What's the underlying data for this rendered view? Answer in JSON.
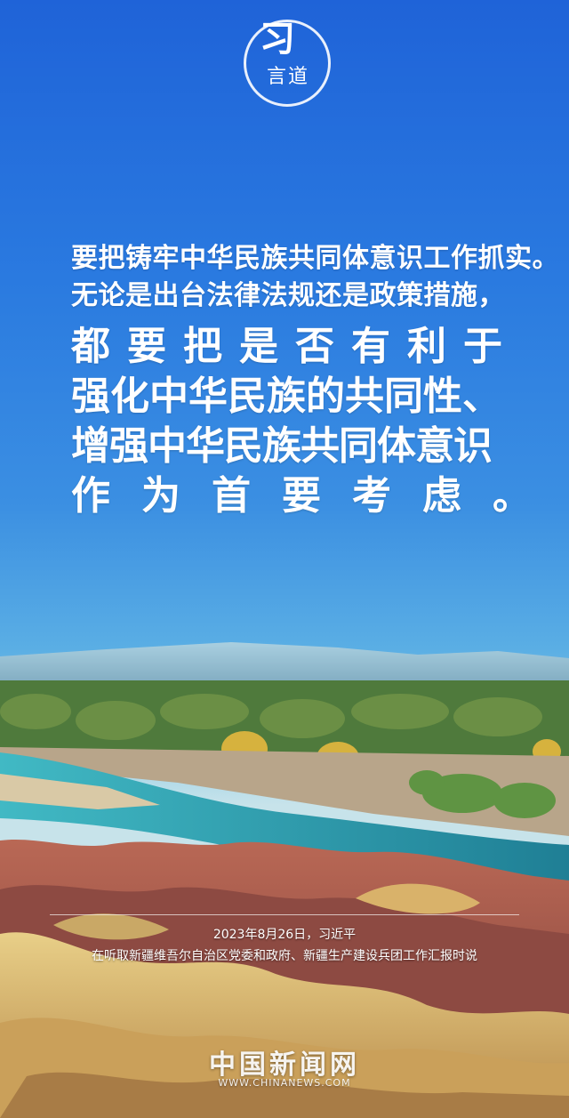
{
  "logo": {
    "char_big": "习",
    "chars_small": "言道"
  },
  "quote": {
    "line1": "要把铸牢中华民族共同体意识工作抓实。",
    "line2": "无论是出台法律法规还是政策措施，",
    "line3": "都要把是否有利于",
    "line4": "强化中华民族的共同性、",
    "line5": "增强中华民族共同体意识",
    "line6": "作为首要考虑。"
  },
  "caption": {
    "date_speaker": "2023年8月26日，习近平",
    "occasion": "在听取新疆维吾尔自治区党委和政府、新疆生产建设兵团工作汇报时说"
  },
  "watermark": {
    "name": "中国新闻网",
    "url": "WWW.CHINANEWS.COM"
  },
  "colors": {
    "sky_top": "#1f63d8",
    "river": "#2fa9b8",
    "rock_red": "#a8574a",
    "rock_yellow": "#d9b465"
  }
}
